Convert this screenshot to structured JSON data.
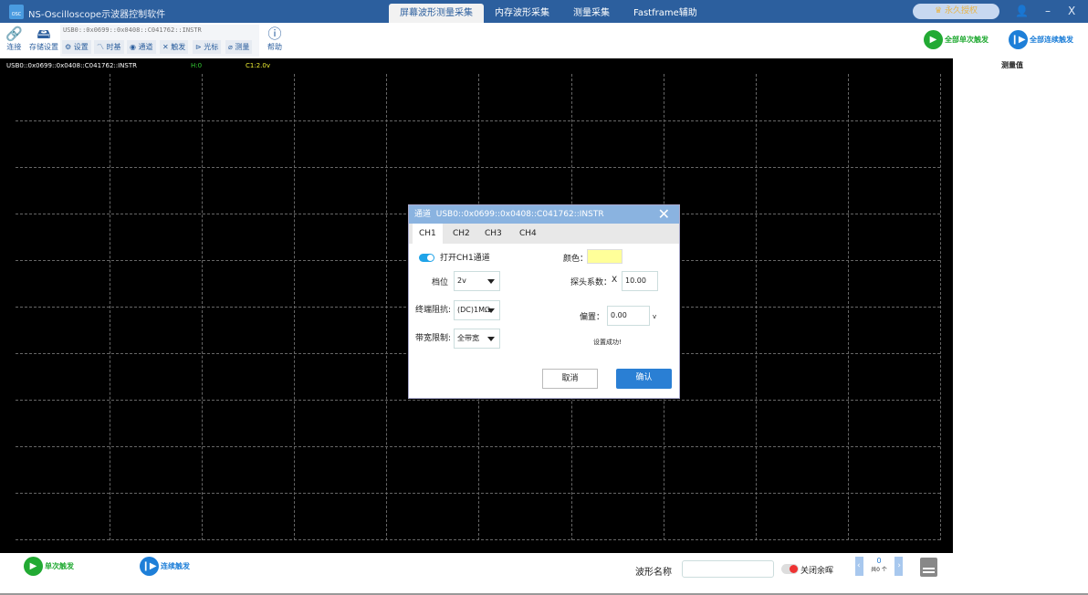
{
  "app": {
    "title": "NS-Oscilloscope示波器控制软件",
    "logo_text": "OSC"
  },
  "tabs": [
    "屏幕波形测量采集",
    "内存波形采集",
    "测量采集",
    "Fastframe辅助"
  ],
  "license": "永久授权",
  "window": {
    "min": "–",
    "close": "X"
  },
  "toolbar": {
    "connect": "连接",
    "storage": "存储设置",
    "instrument": "USB0::0x0699::0x0408::C041762::INSTR",
    "group": [
      "设置",
      "时基",
      "通道",
      "触发",
      "光标",
      "测量"
    ],
    "help": "帮助",
    "all_single": "全部单次触发",
    "all_continuous": "全部连续触发"
  },
  "scope": {
    "instrument": "USB0::0x0699::0x0408::C041762::INSTR",
    "h": "H:0",
    "c1": "C1:2.0v"
  },
  "side": {
    "title": "测量值"
  },
  "bottom": {
    "single": "单次触发",
    "continuous": "连续触发",
    "wave_name_label": "波形名称",
    "wave_name_value": "",
    "persist": "关闭余晖",
    "counter": "0",
    "counter_total": "共0 个"
  },
  "dialog": {
    "title_prefix": "通道",
    "title": "USB0::0x0699::0x0408::C041762::INSTR",
    "tabs": [
      "CH1",
      "CH2",
      "CH3",
      "CH4"
    ],
    "enable_label": "打开CH1通道",
    "color_label": "颜色：",
    "color": "#ffff99",
    "scale_label": "档位",
    "scale_value": "2v",
    "probe_label": "探头系数：",
    "probe_x": "X",
    "probe_value": "10.00",
    "impedance_label": "终端阻抗:",
    "impedance_value": "(DC)1MΩ",
    "offset_label": "偏置：",
    "offset_value": "0.00",
    "offset_unit": "v",
    "bandwidth_label": "带宽限制:",
    "bandwidth_value": "全带宽",
    "status": "设置成功!",
    "cancel": "取消",
    "ok": "确认"
  },
  "colors": {
    "titlebar": "#2c5f9e",
    "accent": "#2a7fd4",
    "green": "#22aa33",
    "blue": "#1e7fd8"
  }
}
